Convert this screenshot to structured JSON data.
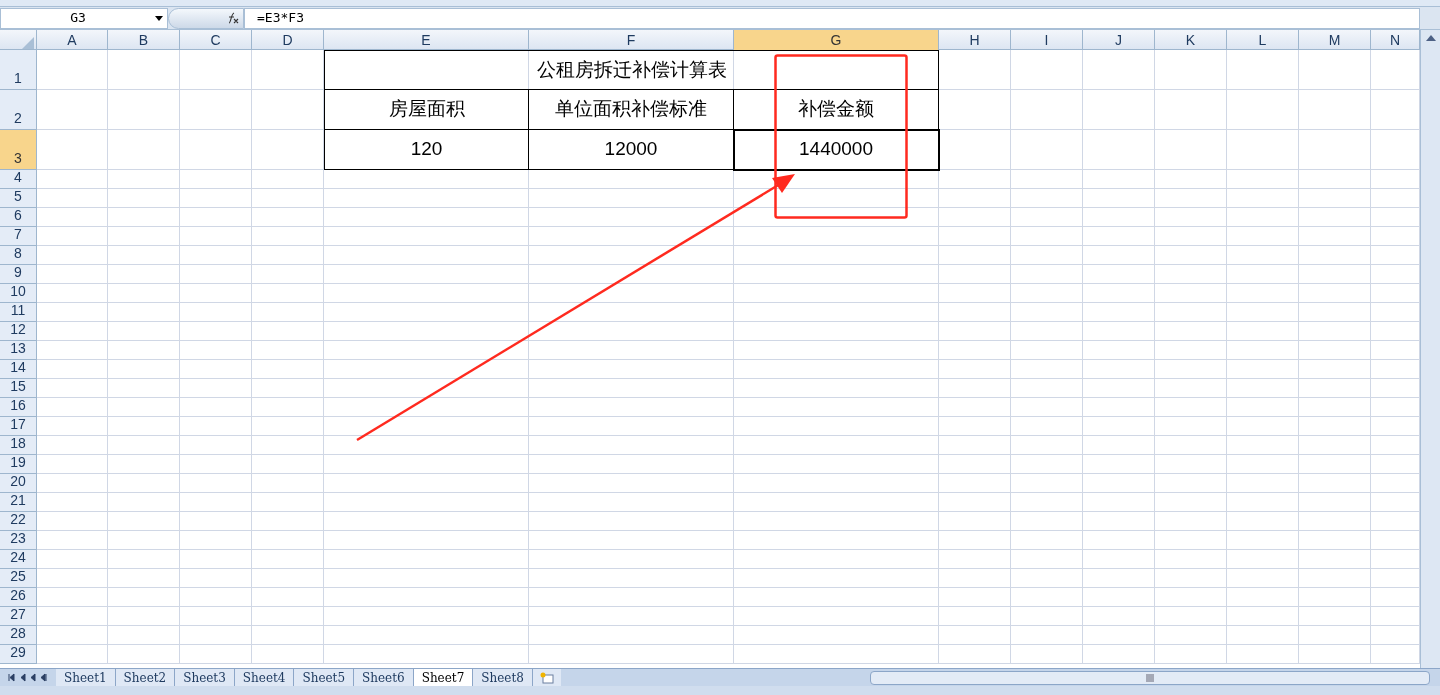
{
  "formula_bar": {
    "name_box": "G3",
    "formula": "=E3*F3"
  },
  "columns": [
    {
      "label": "A",
      "selected": false
    },
    {
      "label": "B",
      "selected": false
    },
    {
      "label": "C",
      "selected": false
    },
    {
      "label": "D",
      "selected": false
    },
    {
      "label": "E",
      "selected": false
    },
    {
      "label": "F",
      "selected": false
    },
    {
      "label": "G",
      "selected": true
    },
    {
      "label": "H",
      "selected": false
    },
    {
      "label": "I",
      "selected": false
    },
    {
      "label": "J",
      "selected": false
    },
    {
      "label": "K",
      "selected": false
    },
    {
      "label": "L",
      "selected": false
    },
    {
      "label": "M",
      "selected": false
    },
    {
      "label": "N",
      "selected": false
    }
  ],
  "rows": [
    {
      "label": "1",
      "selected": false
    },
    {
      "label": "2",
      "selected": false
    },
    {
      "label": "3",
      "selected": true
    },
    {
      "label": "4",
      "selected": false
    },
    {
      "label": "5",
      "selected": false
    },
    {
      "label": "6",
      "selected": false
    },
    {
      "label": "7",
      "selected": false
    },
    {
      "label": "8",
      "selected": false
    },
    {
      "label": "9",
      "selected": false
    },
    {
      "label": "10",
      "selected": false
    },
    {
      "label": "11",
      "selected": false
    },
    {
      "label": "12",
      "selected": false
    },
    {
      "label": "13",
      "selected": false
    },
    {
      "label": "14",
      "selected": false
    },
    {
      "label": "15",
      "selected": false
    },
    {
      "label": "16",
      "selected": false
    },
    {
      "label": "17",
      "selected": false
    },
    {
      "label": "18",
      "selected": false
    },
    {
      "label": "19",
      "selected": false
    },
    {
      "label": "20",
      "selected": false
    },
    {
      "label": "21",
      "selected": false
    },
    {
      "label": "22",
      "selected": false
    },
    {
      "label": "23",
      "selected": false
    },
    {
      "label": "24",
      "selected": false
    },
    {
      "label": "25",
      "selected": false
    },
    {
      "label": "26",
      "selected": false
    },
    {
      "label": "27",
      "selected": false
    },
    {
      "label": "28",
      "selected": false
    },
    {
      "label": "29",
      "selected": false
    }
  ],
  "table": {
    "title": "公租房拆迁补偿计算表",
    "headers": [
      "房屋面积",
      "单位面积补偿标准",
      "补偿金额"
    ],
    "values": [
      {
        "text": "120",
        "selected": false
      },
      {
        "text": "12000",
        "selected": false
      },
      {
        "text": "1440000",
        "selected": true
      }
    ]
  },
  "sheets": [
    {
      "label": "Sheet1",
      "selected": false
    },
    {
      "label": "Sheet2",
      "selected": false
    },
    {
      "label": "Sheet3",
      "selected": false
    },
    {
      "label": "Sheet4",
      "selected": false
    },
    {
      "label": "Sheet5",
      "selected": false
    },
    {
      "label": "Sheet6",
      "selected": false
    },
    {
      "label": "Sheet7",
      "selected": true
    },
    {
      "label": "Sheet8",
      "selected": false
    }
  ]
}
